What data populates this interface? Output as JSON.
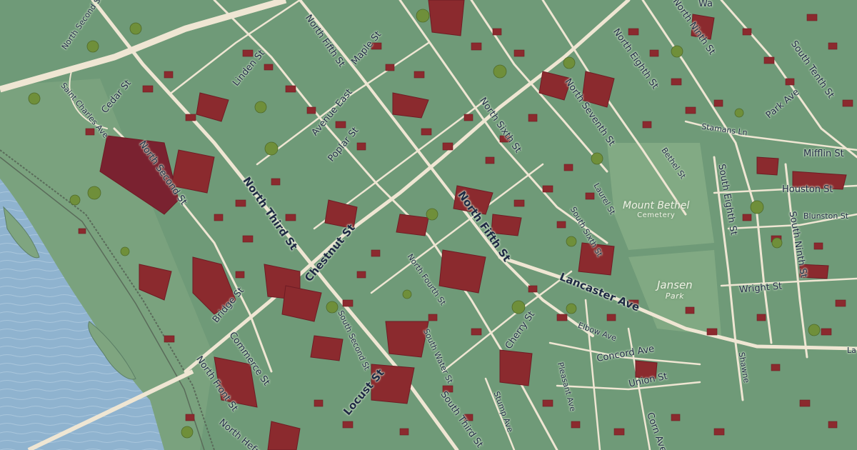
{
  "map": {
    "colors": {
      "land": "#6f9a78",
      "land_light": "#86ad86",
      "water": "#8fb3cf",
      "road": "#efe6d3",
      "building": "#8b2a2e",
      "building_dark": "#6e1c24",
      "tree": "#6f8f3a",
      "label": "#1f2a44"
    },
    "streets": {
      "north_second_st_top": "North Second St",
      "cedar_st": "Cedar St",
      "linden_st": "Linden St",
      "north_fifth_st_top": "North Fifth St",
      "maple_st": "Maple St",
      "saint_charles_ave": "Saint Charles Ave",
      "avenue_east": "Avenue East",
      "poplar_st": "Poplar St",
      "north_second_st": "North Second St",
      "north_third_st": "North Third St",
      "chestnut_st": "Chestnut St",
      "bridge_st": "Bridge St",
      "commerce_st": "Commerce St",
      "north_front_st": "North Front St",
      "locust_st": "Locust St",
      "north_hefner": "North Hefn",
      "north_fourth_st": "North Fourth St",
      "south_second_st": "South Second St",
      "south_water_st": "South Water St",
      "south_third_st": "South Third St",
      "north_sixth_st": "North Sixth St",
      "north_fifth_st": "North Fifth St",
      "north_seventh_st": "North Seventh St",
      "north_eighth_st": "North Eighth St",
      "north_ninth_st": "North Ninth St",
      "walnut_partial": "Wa",
      "south_tenth_st": "South Tenth St",
      "park_ave": "Park Ave",
      "stamans_ln": "Stamans Ln",
      "bethel_st": "Bethel St",
      "laurel_st": "Laurel St",
      "south_sixth_st": "South Sixth St",
      "mifflin_st": "Mifflin St",
      "houston_st": "Houston St",
      "blunston_st": "Blunston St",
      "south_eighth_st": "South Eighth St",
      "south_ninth_st": "South Ninth St",
      "wright_st": "Wright St",
      "lancaster_ave": "Lancaster Ave",
      "cherry_st": "Cherry St",
      "elbow_ave": "Elbow Ave",
      "concord_ave": "Concord Ave",
      "union_st": "Union St",
      "pleasant_ave": "Pleasant Ave",
      "stump_ave": "Stump Ave",
      "corn_ave": "Corn Ave",
      "shawnee_partial": "Shawne",
      "lancaster_partial": "La"
    },
    "places": {
      "mount_bethel": "Mount Bethel",
      "cemetery": "Cemetery",
      "jansen": "Jansen",
      "park": "Park"
    }
  }
}
